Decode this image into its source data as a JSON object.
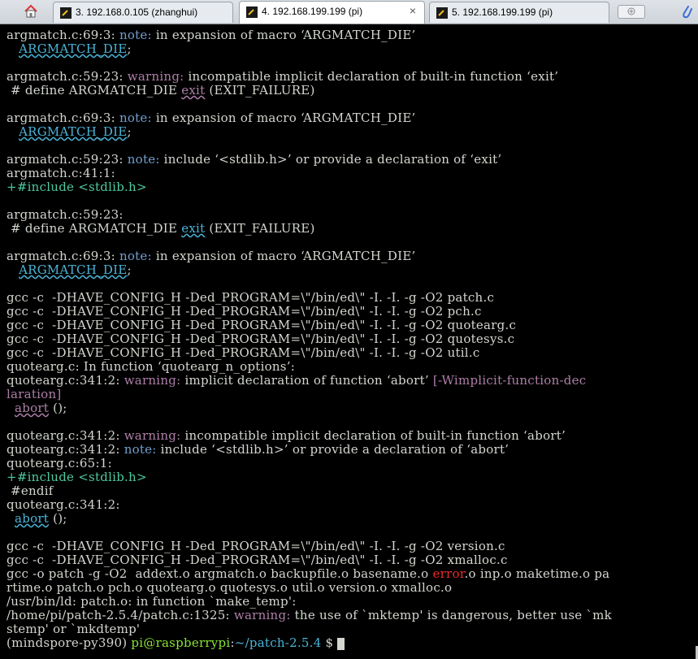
{
  "tabs": [
    {
      "label": "3. 192.168.0.105 (zhanghui)",
      "active": false
    },
    {
      "label": "4. 192.168.199.199 (pi)",
      "active": true,
      "close": "×"
    },
    {
      "label": "5. 192.168.199.199 (pi)",
      "active": false
    }
  ],
  "terminal": {
    "l1": {
      "a": "argmatch.c:69:3: ",
      "b": "note:",
      "c": " in expansion of macro ‘ARGMATCH_DIE’"
    },
    "l2": {
      "a": "   ",
      "b": "ARGMATCH_DIE",
      "c": ";"
    },
    "l3": {
      "a": "argmatch.c:59:23: ",
      "b": "warning:",
      "c": " incompatible implicit declaration of built-in function ‘exit’"
    },
    "l4": {
      "a": " # define ARGMATCH_DIE ",
      "b": "exit",
      "c": " (EXIT_FAILURE)"
    },
    "l5": {
      "a": "argmatch.c:69:3: ",
      "b": "note:",
      "c": " in expansion of macro ‘ARGMATCH_DIE’"
    },
    "l6": {
      "a": "   ",
      "b": "ARGMATCH_DIE",
      "c": ";"
    },
    "l7": {
      "a": "argmatch.c:59:23: ",
      "b": "note:",
      "c": " include ‘<stdlib.h>’ or provide a declaration of ‘exit’"
    },
    "l8": "argmatch.c:41:1:",
    "l9": "+#include <stdlib.h>",
    "l10": "argmatch.c:59:23:",
    "l11": {
      "a": " # define ARGMATCH_DIE ",
      "b": "exit",
      "c": " (EXIT_FAILURE)"
    },
    "l12": {
      "a": "argmatch.c:69:3: ",
      "b": "note:",
      "c": " in expansion of macro ‘ARGMATCH_DIE’"
    },
    "l13": {
      "a": "   ",
      "b": "ARGMATCH_DIE",
      "c": ";"
    },
    "l14": "gcc -c  -DHAVE_CONFIG_H -Ded_PROGRAM=\\\"/bin/ed\\\" -I. -I. -g -O2 patch.c",
    "l15": "gcc -c  -DHAVE_CONFIG_H -Ded_PROGRAM=\\\"/bin/ed\\\" -I. -I. -g -O2 pch.c",
    "l16": "gcc -c  -DHAVE_CONFIG_H -Ded_PROGRAM=\\\"/bin/ed\\\" -I. -I. -g -O2 quotearg.c",
    "l17": "gcc -c  -DHAVE_CONFIG_H -Ded_PROGRAM=\\\"/bin/ed\\\" -I. -I. -g -O2 quotesys.c",
    "l18": "gcc -c  -DHAVE_CONFIG_H -Ded_PROGRAM=\\\"/bin/ed\\\" -I. -I. -g -O2 util.c",
    "l19": "quotearg.c: In function ‘quotearg_n_options’:",
    "l20": {
      "a": "quotearg.c:341:2: ",
      "b": "warning:",
      "c": " implicit declaration of function ‘abort’ ",
      "d": "[-Wimplicit-function-dec"
    },
    "l21": "laration]",
    "l22": {
      "a": "  ",
      "b": "abort",
      "c": " ();"
    },
    "l23": {
      "a": "quotearg.c:341:2: ",
      "b": "warning:",
      "c": " incompatible implicit declaration of built-in function ‘abort’"
    },
    "l24": {
      "a": "quotearg.c:341:2: ",
      "b": "note:",
      "c": " include ‘<stdlib.h>’ or provide a declaration of ‘abort’"
    },
    "l25": "quotearg.c:65:1:",
    "l26": "+#include <stdlib.h>",
    "l27": " #endif",
    "l28": "quotearg.c:341:2:",
    "l29": {
      "a": "  ",
      "b": "abort",
      "c": " ();"
    },
    "l30": "gcc -c  -DHAVE_CONFIG_H -Ded_PROGRAM=\\\"/bin/ed\\\" -I. -I. -g -O2 version.c",
    "l31": "gcc -c  -DHAVE_CONFIG_H -Ded_PROGRAM=\\\"/bin/ed\\\" -I. -I. -g -O2 xmalloc.c",
    "l32": {
      "a": "gcc -o patch -g -O2  addext.o argmatch.o backupfile.o basename.o ",
      "b": "error",
      "c": ".o inp.o maketime.o pa"
    },
    "l33": "rtime.o patch.o pch.o quotearg.o quotesys.o util.o version.o xmalloc.o",
    "l34": "/usr/bin/ld: patch.o: in function `make_temp':",
    "l35": {
      "a": "/home/pi/patch-2.5.4/patch.c:1325: ",
      "b": "warning:",
      "c": " the use of `mktemp' is dangerous, better use `mk"
    },
    "l36": "stemp' or `mkdtemp'",
    "l37": {
      "a": "(mindspore-py390) ",
      "b": "pi@raspberrypi",
      "c": ":",
      "d": "~/patch-2.5.4",
      "e": " $ "
    }
  }
}
